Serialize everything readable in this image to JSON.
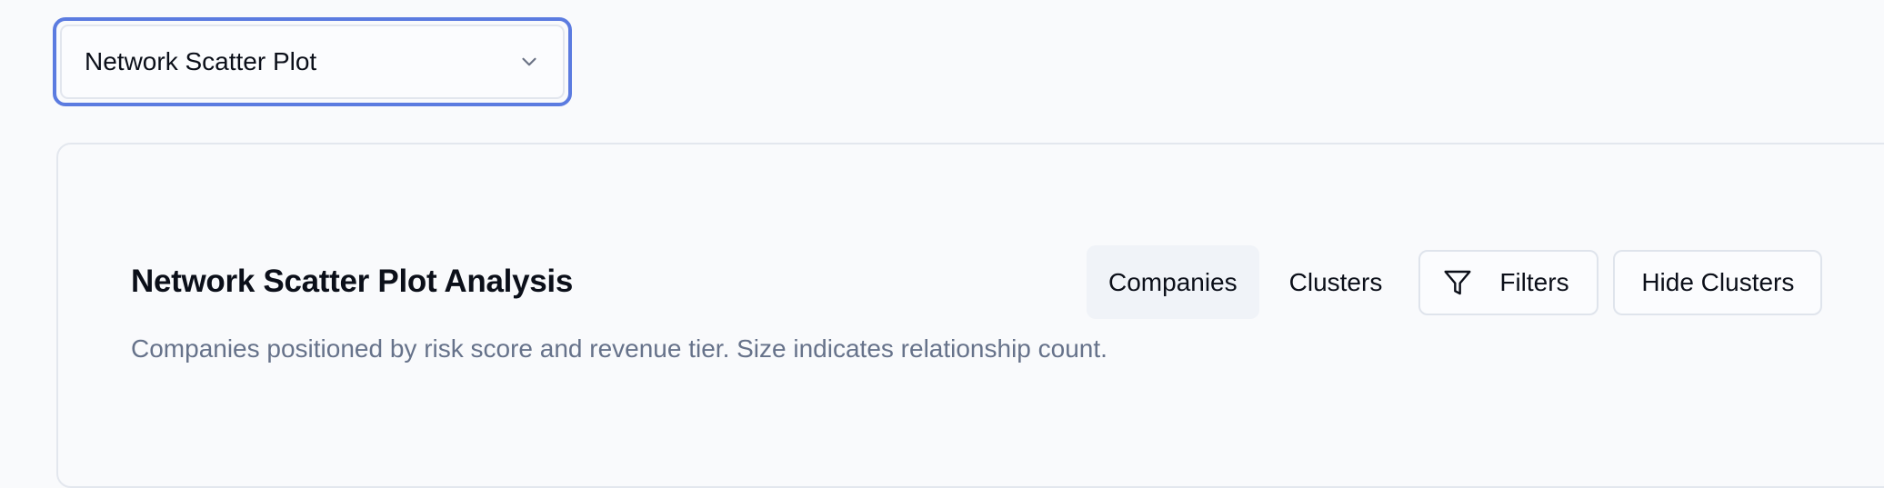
{
  "view_selector": {
    "selected": "Network Scatter Plot",
    "icon": "chevron-down-icon"
  },
  "card": {
    "title": "Network Scatter Plot Analysis",
    "subtitle": "Companies positioned by risk score and revenue tier. Size indicates relationship count."
  },
  "toolbar": {
    "tabs": [
      {
        "label": "Companies",
        "active": true
      },
      {
        "label": "Clusters",
        "active": false
      }
    ],
    "filters_label": "Filters",
    "filters_icon": "filter-icon",
    "hide_clusters_label": "Hide Clusters"
  },
  "colors": {
    "focus_ring": "#5b7be0",
    "background": "#f9fafc",
    "border": "#e3e7ee",
    "muted_text": "#66728a",
    "active_tab_bg": "#f0f3f8"
  }
}
